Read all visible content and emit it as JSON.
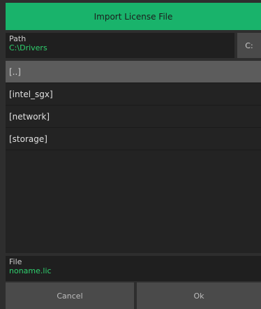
{
  "dialog": {
    "title": "Import License File",
    "path": {
      "caption": "Path",
      "value": "C:\\Drivers"
    },
    "drive_button_label": "C:",
    "items": [
      {
        "label": "[..]"
      },
      {
        "label": "[intel_sgx]"
      },
      {
        "label": "[network]"
      },
      {
        "label": "[storage]"
      }
    ],
    "file": {
      "caption": "File",
      "value": "noname.lic"
    },
    "cancel_label": "Cancel",
    "ok_label": "Ok"
  },
  "colors": {
    "accent": "#19b36b",
    "value_text": "#2fd06e",
    "selected_row": "#5c5c5c"
  }
}
